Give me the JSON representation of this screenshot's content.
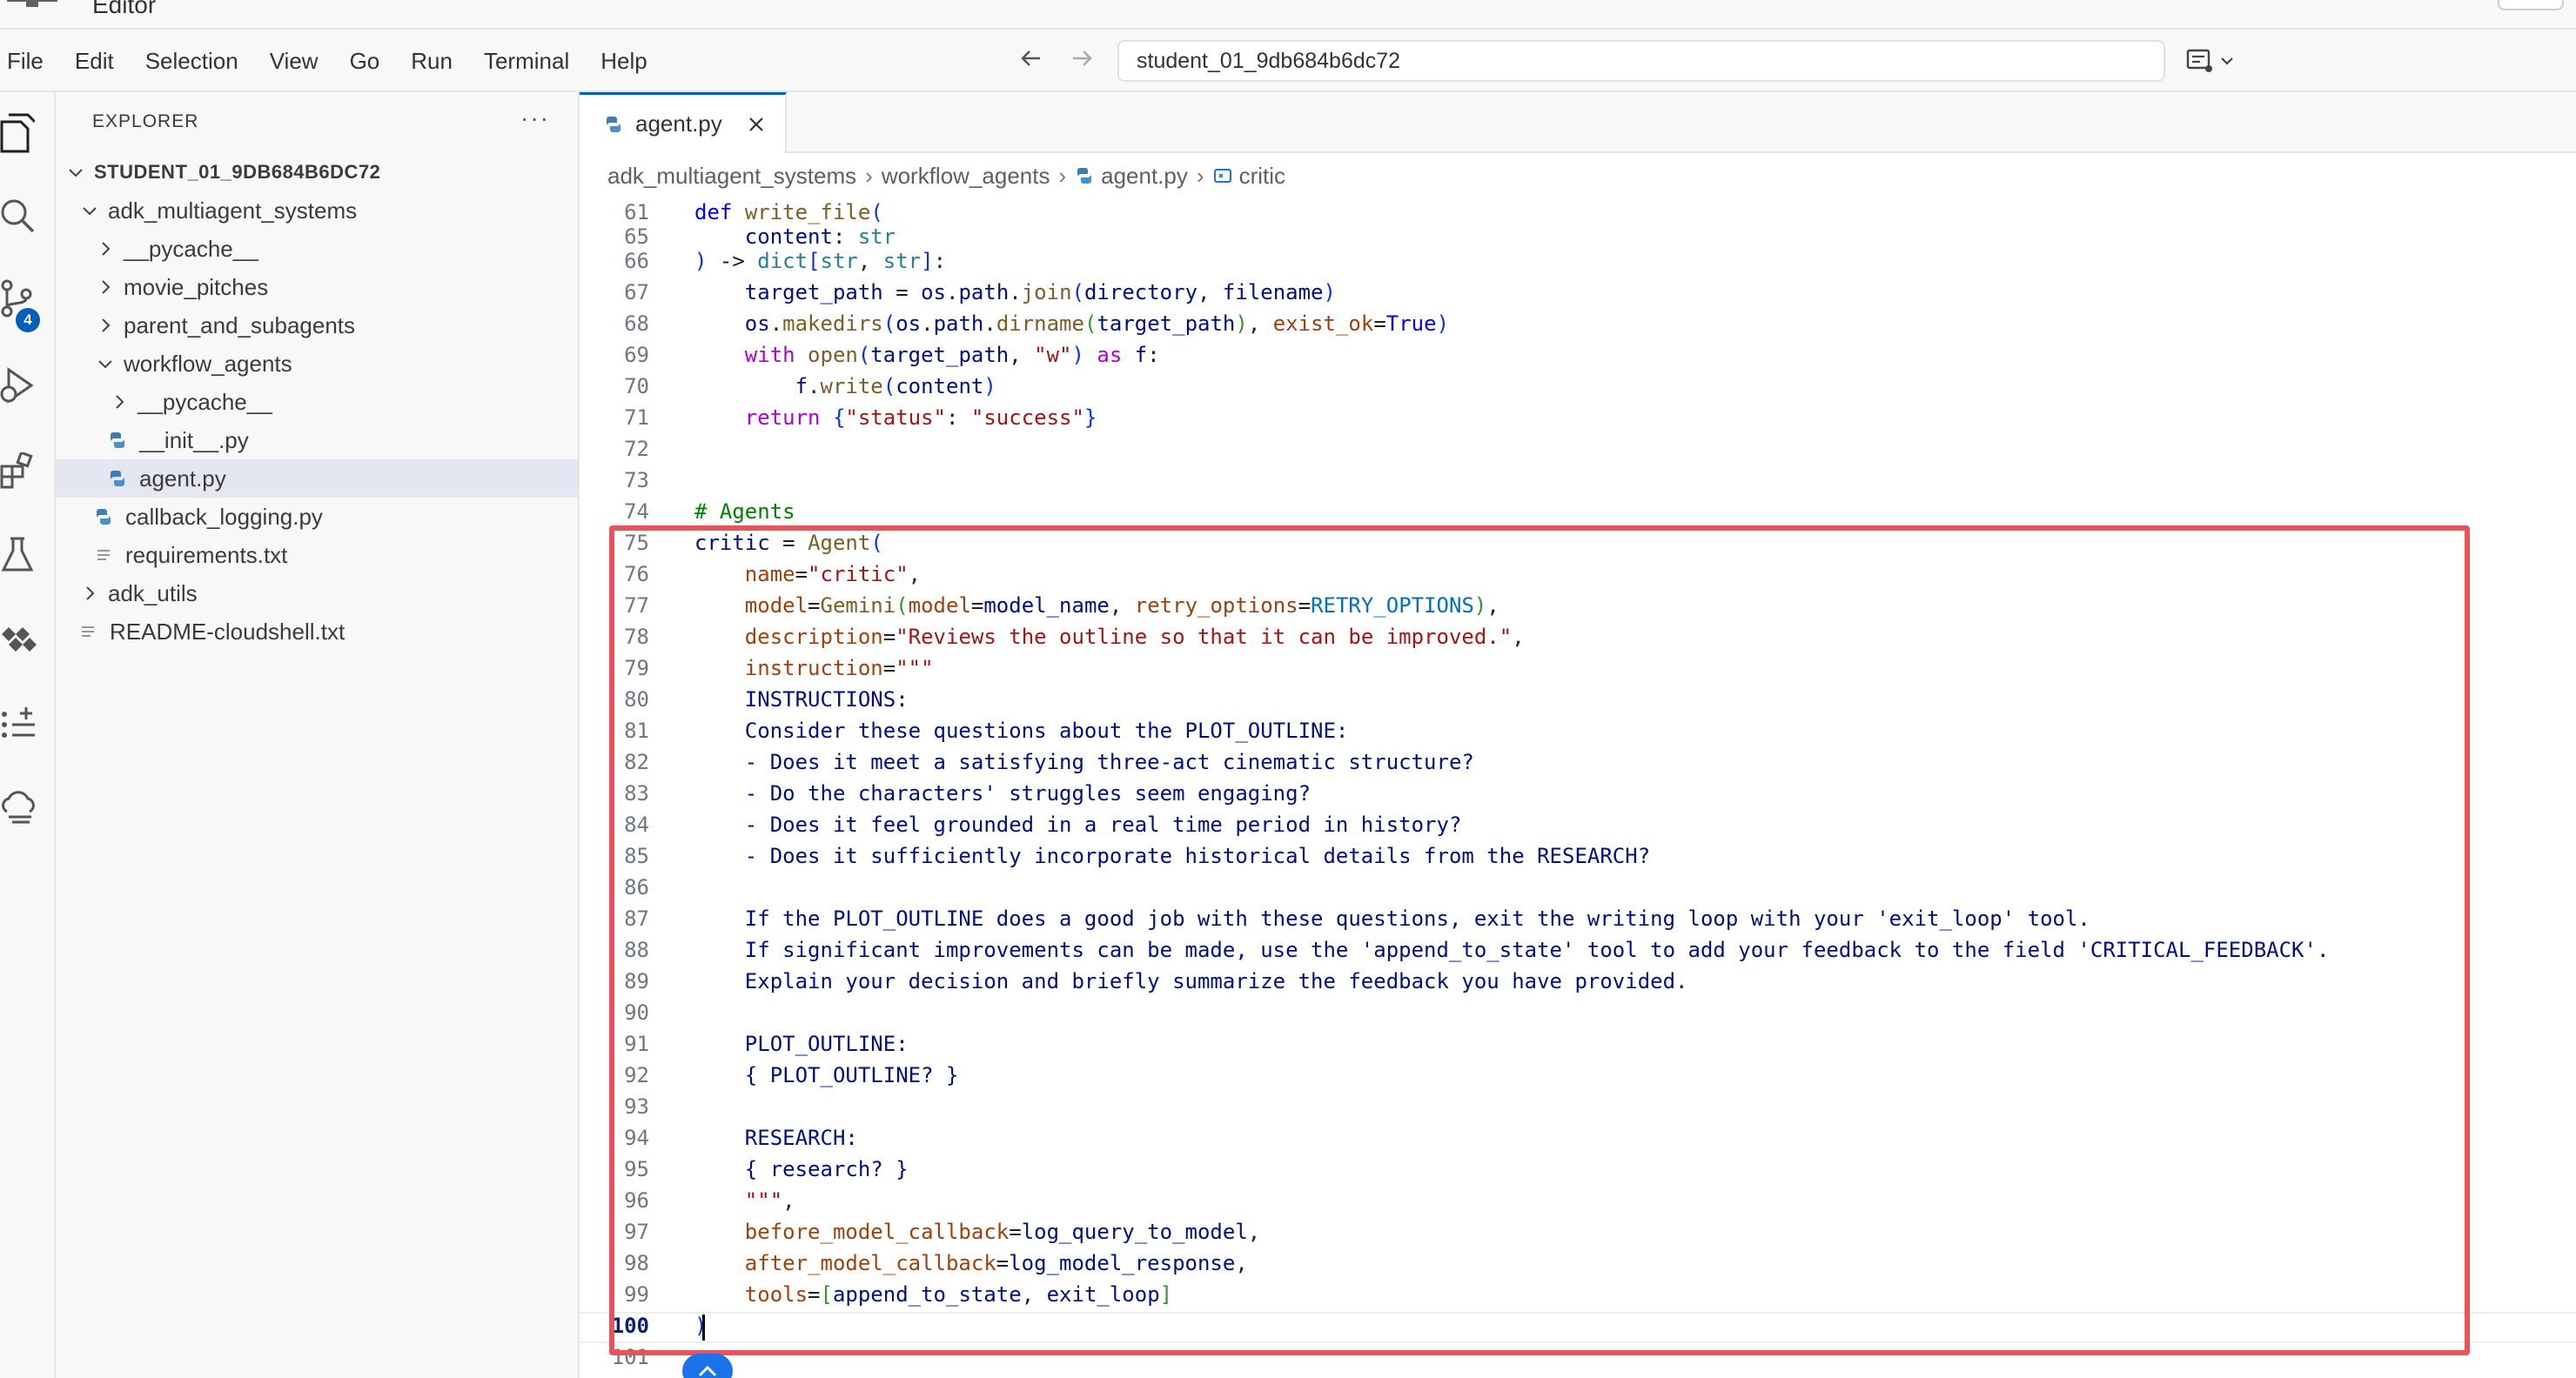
{
  "app": {
    "title": "Editor"
  },
  "menu": [
    "File",
    "Edit",
    "Selection",
    "View",
    "Go",
    "Run",
    "Terminal",
    "Help"
  ],
  "command_center": {
    "value": "student_01_9db684b6dc72"
  },
  "activity_bar": {
    "scm_badge": "4"
  },
  "explorer": {
    "header": "EXPLORER",
    "more": "···",
    "root": "STUDENT_01_9DB684B6DC72",
    "items": [
      {
        "label": "adk_multiagent_systems"
      },
      {
        "label": "__pycache__"
      },
      {
        "label": "movie_pitches"
      },
      {
        "label": "parent_and_subagents"
      },
      {
        "label": "workflow_agents"
      },
      {
        "label": "__pycache__"
      },
      {
        "label": "__init__.py"
      },
      {
        "label": "agent.py"
      },
      {
        "label": "callback_logging.py"
      },
      {
        "label": "requirements.txt"
      },
      {
        "label": "adk_utils"
      },
      {
        "label": "README-cloudshell.txt"
      }
    ]
  },
  "editor": {
    "tab": {
      "label": "agent.py"
    },
    "breadcrumbs": [
      "adk_multiagent_systems",
      "workflow_agents",
      "agent.py",
      "critic"
    ],
    "line_numbers": [
      "61",
      "65",
      "66",
      "67",
      "68",
      "69",
      "70",
      "71",
      "72",
      "73",
      "74",
      "75",
      "76",
      "77",
      "78",
      "79",
      "80",
      "81",
      "82",
      "83",
      "84",
      "85",
      "86",
      "87",
      "88",
      "89",
      "90",
      "91",
      "92",
      "93",
      "94",
      "95",
      "96",
      "97",
      "98",
      "99",
      "100",
      "101"
    ]
  }
}
